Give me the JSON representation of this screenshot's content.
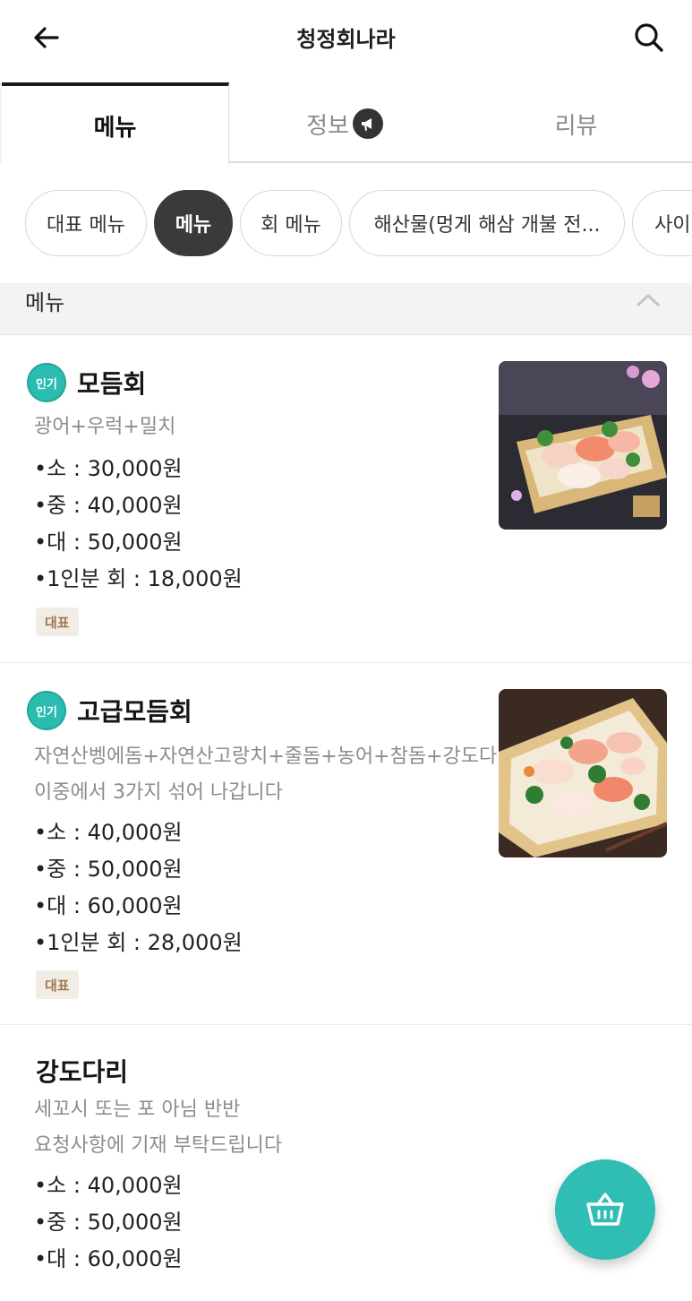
{
  "header": {
    "title": "청정회나라",
    "back_icon": "arrow-left-icon",
    "search_icon": "search-icon"
  },
  "tabs": [
    {
      "label": "메뉴",
      "active": true
    },
    {
      "label": "정보",
      "active": false,
      "badge_icon": "megaphone-icon"
    },
    {
      "label": "리뷰",
      "active": false
    }
  ],
  "chips": [
    {
      "label": "대표 메뉴",
      "active": false
    },
    {
      "label": "메뉴",
      "active": true
    },
    {
      "label": "회 메뉴",
      "active": false
    },
    {
      "label": "해산물(멍게 해삼 개불 전...",
      "active": false
    },
    {
      "label": "사이",
      "active": false
    }
  ],
  "section": {
    "title": "메뉴",
    "collapse_icon": "chevron-up-icon"
  },
  "items": [
    {
      "badge": "인기",
      "name": "모듬회",
      "desc": [
        "광어+우럭+밀치"
      ],
      "prices": [
        "•소 : 30,000원",
        "•중 : 40,000원",
        "•대 : 50,000원",
        "•1인분 회 : 18,000원"
      ],
      "tag": "대표"
    },
    {
      "badge": "인기",
      "name": "고급모듬회",
      "desc": [
        "자연산벵에돔+자연산고랑치+줄돔+농어+참돔+강도다리",
        "이중에서 3가지 섞어 나갑니다"
      ],
      "prices": [
        "•소 : 40,000원",
        "•중 : 50,000원",
        "•대 : 60,000원",
        "•1인분 회 : 28,000원"
      ],
      "tag": "대표"
    },
    {
      "name": "강도다리",
      "desc": [
        "세꼬시 또는 포 아님 반반",
        "요청사항에 기재 부탁드립니다"
      ],
      "prices": [
        "•소 : 40,000원",
        "•중 : 50,000원",
        "•대 : 60,000원"
      ]
    }
  ],
  "cart_icon": "basket-icon",
  "colors": {
    "accent": "#30bdb3",
    "popular_badge": "#2bbcb0",
    "tag_bg": "#f2ece6",
    "tag_text": "#a0764e",
    "active_chip": "#3a3a3a"
  }
}
